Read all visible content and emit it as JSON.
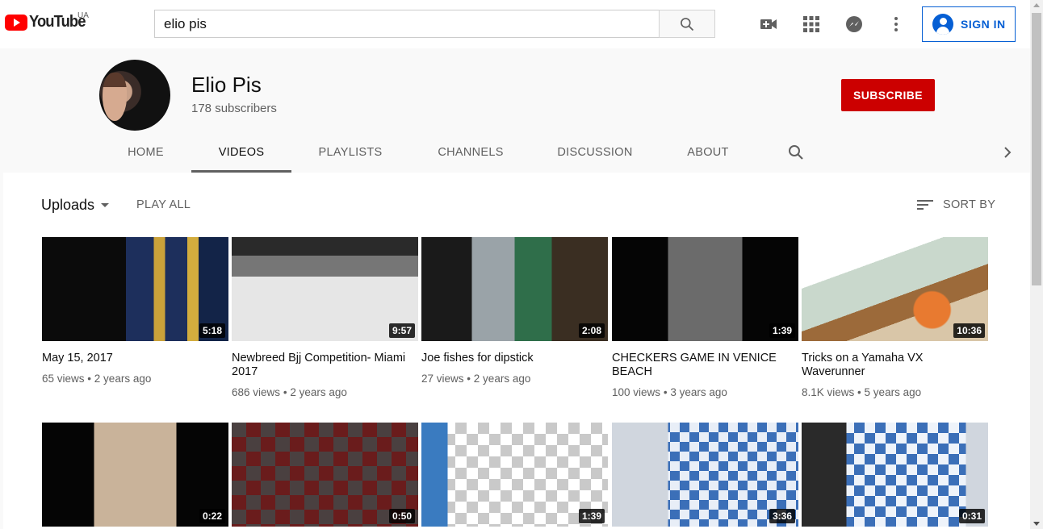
{
  "masthead": {
    "logo_text": "YouTube",
    "country_code": "UA",
    "search_value": "elio pis",
    "sign_in_label": "SIGN IN"
  },
  "channel": {
    "name": "Elio Pis",
    "subscribers": "178 subscribers",
    "subscribe_label": "SUBSCRIBE"
  },
  "tabs": [
    {
      "label": "HOME"
    },
    {
      "label": "VIDEOS"
    },
    {
      "label": "PLAYLISTS"
    },
    {
      "label": "CHANNELS"
    },
    {
      "label": "DISCUSSION"
    },
    {
      "label": "ABOUT"
    }
  ],
  "toolbar": {
    "uploads_label": "Uploads",
    "play_all_label": "PLAY ALL",
    "sort_by_label": "SORT BY"
  },
  "videos": [
    {
      "title": "May 15, 2017",
      "duration": "5:18",
      "views": "65 views",
      "age": "2 years ago"
    },
    {
      "title": "Newbreed Bjj Competition- Miami 2017",
      "duration": "9:57",
      "views": "686 views",
      "age": "2 years ago"
    },
    {
      "title": "Joe fishes for dipstick",
      "duration": "2:08",
      "views": "27 views",
      "age": "2 years ago"
    },
    {
      "title": "CHECKERS GAME IN VENICE BEACH",
      "duration": "1:39",
      "views": "100 views",
      "age": "3 years ago"
    },
    {
      "title": "Tricks on a Yamaha VX Waverunner",
      "duration": "10:36",
      "views": "8.1K views",
      "age": "5 years ago"
    },
    {
      "duration": "0:22"
    },
    {
      "duration": "0:50"
    },
    {
      "duration": "1:39"
    },
    {
      "duration": "3:36"
    },
    {
      "duration": "0:31"
    }
  ],
  "meta_separator": "•",
  "colors": {
    "brand_red": "#ff0000",
    "subscribe_red": "#cc0000",
    "link_blue": "#065fd4"
  }
}
